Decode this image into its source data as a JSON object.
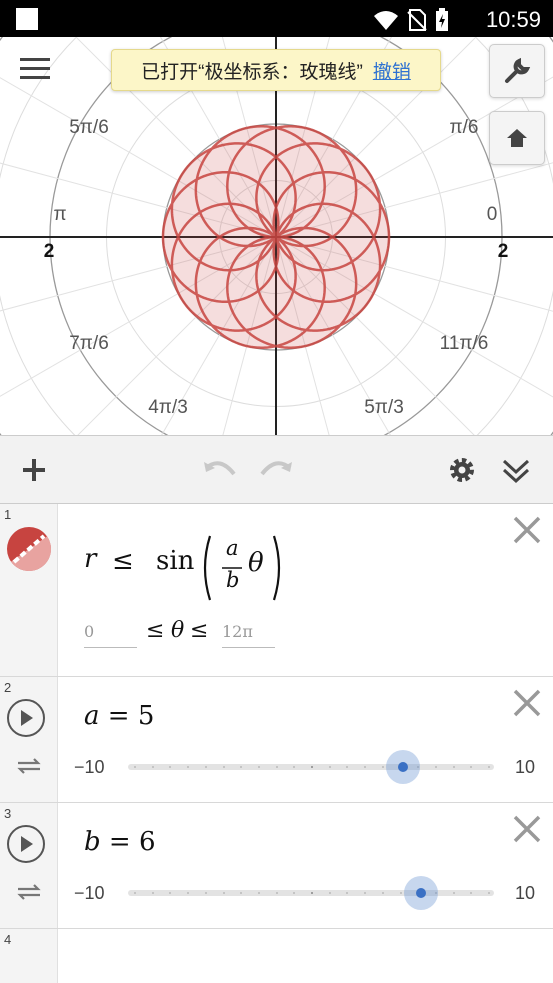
{
  "status": {
    "time": "10:59"
  },
  "graph": {
    "angle_labels": [
      "5π/6",
      "π/6",
      "π",
      "0",
      "7π/6",
      "11π/6",
      "4π/3",
      "5π/3"
    ],
    "axis_labels": [
      "2",
      "2"
    ],
    "curve_color": "#c74440"
  },
  "toast": {
    "message": "已打开“极坐标系：玫瑰线”",
    "undo_label": "撤销"
  },
  "expressions": [
    {
      "index": "1",
      "latex_parts": {
        "r": "r",
        "le": "≤",
        "sin": "sin",
        "a": "a",
        "b": "b",
        "theta": "θ"
      },
      "domain": {
        "min": "0",
        "max": "12π",
        "theta": "θ",
        "le1": "≤",
        "le2": "≤"
      }
    },
    {
      "index": "2",
      "var": "a",
      "eq": "=",
      "value": "5",
      "slider": {
        "min_label": "−10",
        "max_label": "10",
        "value": 5,
        "min": -10,
        "max": 10
      }
    },
    {
      "index": "3",
      "var": "b",
      "eq": "=",
      "value": "6",
      "slider": {
        "min_label": "−10",
        "max_label": "10",
        "value": 6,
        "min": -10,
        "max": 10
      }
    },
    {
      "index": "4"
    }
  ]
}
